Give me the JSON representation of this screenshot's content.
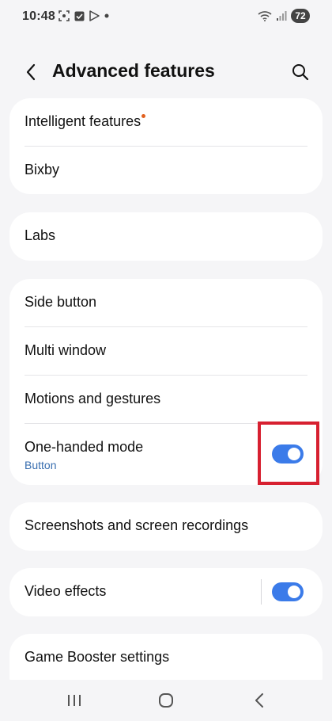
{
  "status_bar": {
    "time": "10:48",
    "battery": "72"
  },
  "header": {
    "title": "Advanced features"
  },
  "cards": {
    "group1": {
      "items": [
        {
          "label": "Intelligent features"
        },
        {
          "label": "Bixby"
        }
      ]
    },
    "group2": {
      "items": [
        {
          "label": "Labs"
        }
      ]
    },
    "group3": {
      "items": [
        {
          "label": "Side button"
        },
        {
          "label": "Multi window"
        },
        {
          "label": "Motions and gestures"
        },
        {
          "label": "One-handed mode",
          "sub": "Button",
          "toggle": "on"
        }
      ]
    },
    "group4": {
      "items": [
        {
          "label": "Screenshots and screen recordings"
        }
      ]
    },
    "group5": {
      "items": [
        {
          "label": "Video effects",
          "toggle": "on"
        }
      ]
    },
    "group6": {
      "items": [
        {
          "label": "Game Booster settings"
        }
      ]
    }
  },
  "colors": {
    "accent": "#3b7be9",
    "highlight": "#d72030",
    "badge_dot": "#e1601e",
    "subtext": "#3a6fb0"
  },
  "icons": {
    "back": "chevron-left-icon",
    "search": "search-icon",
    "nav_recent": "recent-apps-icon",
    "nav_home": "home-icon",
    "nav_back": "back-icon"
  }
}
